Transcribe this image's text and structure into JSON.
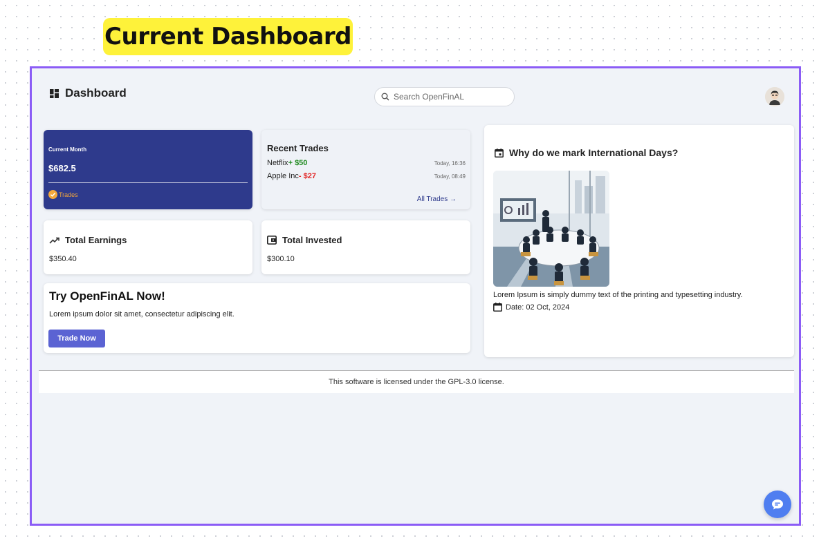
{
  "banner": {
    "title": "Current Dashboard"
  },
  "header": {
    "title": "Dashboard",
    "search_placeholder": "Search OpenFinAL"
  },
  "current_month": {
    "label": "Current Month",
    "amount": "$682.5",
    "trades_label": "Trades"
  },
  "recent_trades": {
    "title": "Recent Trades",
    "items": [
      {
        "name": "Netflix",
        "sign": "+",
        "amount": "$50",
        "time": "Today, 16:36",
        "color": "#1f8a1f"
      },
      {
        "name": "Apple Inc",
        "sign": "-",
        "amount": "$27",
        "time": "Today, 08:49",
        "color": "#e22626"
      }
    ],
    "link": "All Trades →"
  },
  "total_earnings": {
    "title": "Total Earnings",
    "value": "$350.40",
    "icon": "trending-up-icon"
  },
  "total_invested": {
    "title": "Total Invested",
    "value": "$300.10",
    "icon": "wallet-icon"
  },
  "promo": {
    "title": "Try OpenFinAL Now!",
    "text": "Lorem ipsum dolor sit amet, consectetur adipiscing elit.",
    "button": "Trade Now"
  },
  "article": {
    "title": "Why do we mark International Days?",
    "text": "Lorem Ipsum is simply dummy text of the printing and typesetting industry.",
    "date": "Date: 02 Oct, 2024"
  },
  "footer": {
    "text": "This software is licensed under the GPL-3.0 license."
  },
  "colors": {
    "accent_purple": "#8b5cf6",
    "card_navy": "#2e3a8c",
    "button": "#5b63d3",
    "chat": "#4f7ef0",
    "banner_yellow": "#fef23a"
  }
}
